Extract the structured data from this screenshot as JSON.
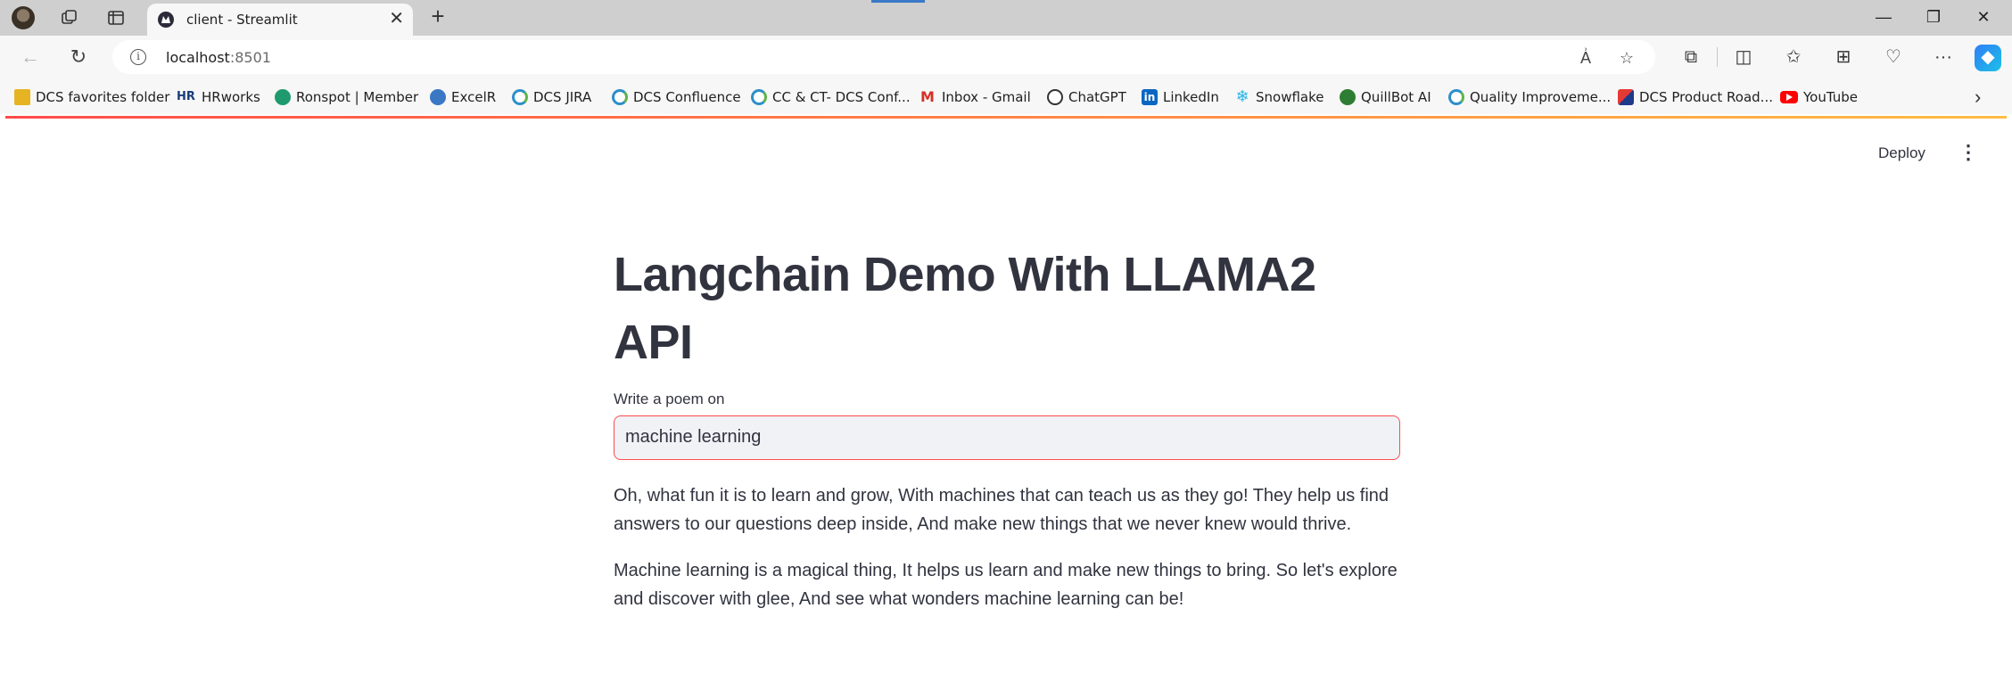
{
  "browser": {
    "tab": {
      "title": "client - Streamlit"
    },
    "address": {
      "host": "localhost",
      "port": ":8501"
    },
    "bookmarks": [
      {
        "label": "DCS favorites folder",
        "icon": "folder-icon"
      },
      {
        "label": "HRworks",
        "icon": "hrworks-icon"
      },
      {
        "label": "Ronspot | Member",
        "icon": "ronspot-icon"
      },
      {
        "label": "ExcelR",
        "icon": "excelr-icon"
      },
      {
        "label": "DCS JIRA",
        "icon": "dcs-icon"
      },
      {
        "label": "DCS Confluence",
        "icon": "dcs-icon"
      },
      {
        "label": "CC & CT- DCS Conf...",
        "icon": "dcs-icon"
      },
      {
        "label": "Inbox - Gmail",
        "icon": "gmail-icon"
      },
      {
        "label": "ChatGPT",
        "icon": "chatgpt-icon"
      },
      {
        "label": "LinkedIn",
        "icon": "linkedin-icon"
      },
      {
        "label": "Snowflake",
        "icon": "snowflake-icon"
      },
      {
        "label": "QuillBot AI",
        "icon": "quillbot-icon"
      },
      {
        "label": "Quality Improveme...",
        "icon": "dcs-icon"
      },
      {
        "label": "DCS Product Road...",
        "icon": "product-icon"
      },
      {
        "label": "YouTube",
        "icon": "youtube-icon"
      }
    ],
    "hr_icon_text": "HR",
    "linkedin_icon_text": "in"
  },
  "app": {
    "deploy_label": "Deploy",
    "title": "Langchain Demo With LLAMA2 API",
    "input_label": "Write a poem on",
    "input_value": "machine learning",
    "output_paragraphs": [
      "Oh, what fun it is to learn and grow, With machines that can teach us as they go! They help us find answers to our questions deep inside, And make new things that we never knew would thrive.",
      "Machine learning is a magical thing, It helps us learn and make new things to bring. So let's explore and discover with glee, And see what wonders machine learning can be!"
    ]
  },
  "colors": {
    "accent": "#ff4b4b",
    "text": "#31333f",
    "input_bg": "#f0f2f6"
  }
}
